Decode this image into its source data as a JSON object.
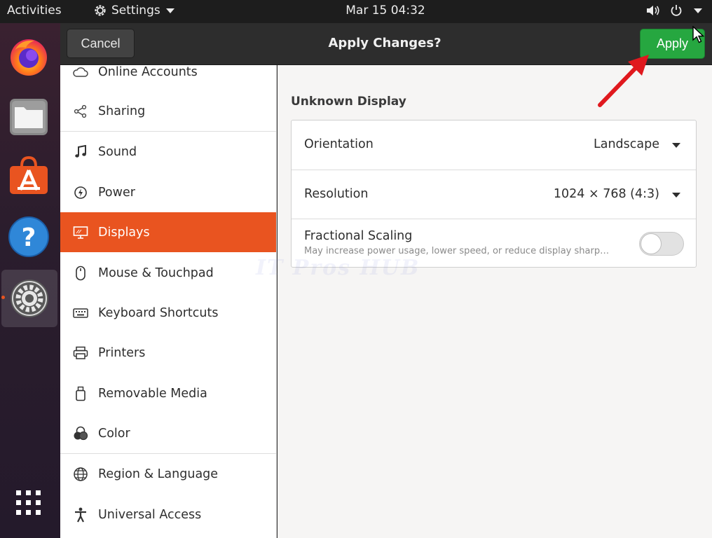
{
  "topbar": {
    "activities": "Activities",
    "app_name": "Settings",
    "clock": "Mar 15  04:32"
  },
  "dock": {
    "items": [
      "firefox-icon",
      "files-icon",
      "software-icon",
      "help-icon",
      "settings-icon",
      "show-apps-icon"
    ]
  },
  "header": {
    "cancel_label": "Cancel",
    "title": "Apply Changes?",
    "apply_label": "Apply"
  },
  "sidebar": {
    "items": [
      {
        "label": "Online Accounts",
        "icon": "cloud-icon"
      },
      {
        "label": "Sharing",
        "icon": "share-icon"
      },
      {
        "label": "Sound",
        "icon": "music-note-icon"
      },
      {
        "label": "Power",
        "icon": "power-icon"
      },
      {
        "label": "Displays",
        "icon": "display-icon"
      },
      {
        "label": "Mouse & Touchpad",
        "icon": "mouse-icon"
      },
      {
        "label": "Keyboard Shortcuts",
        "icon": "keyboard-icon"
      },
      {
        "label": "Printers",
        "icon": "printer-icon"
      },
      {
        "label": "Removable Media",
        "icon": "usb-drive-icon"
      },
      {
        "label": "Color",
        "icon": "color-icon"
      },
      {
        "label": "Region & Language",
        "icon": "globe-icon"
      },
      {
        "label": "Universal Access",
        "icon": "accessibility-icon"
      }
    ],
    "selected": "Displays"
  },
  "main": {
    "section_title": "Unknown Display",
    "orientation": {
      "label": "Orientation",
      "value": "Landscape"
    },
    "resolution": {
      "label": "Resolution",
      "value": "1024 × 768 (4:3)"
    },
    "fractional_scaling": {
      "label": "Fractional Scaling",
      "description": "May increase power usage, lower speed, or reduce display sharp…",
      "enabled": false
    }
  },
  "watermark": "IT Pros HUB",
  "colors": {
    "accent": "#e95420",
    "apply": "#26a740",
    "annotation_arrow": "#e0191e"
  }
}
